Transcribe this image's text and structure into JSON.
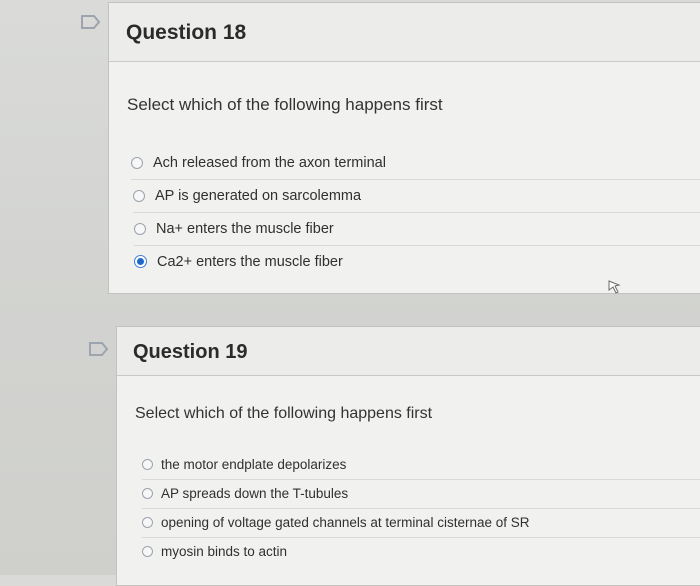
{
  "question18": {
    "title": "Question 18",
    "prompt": "Select which of the following happens first",
    "options": [
      {
        "label": "Ach released from the axon terminal",
        "selected": false
      },
      {
        "label": "AP is generated on sarcolemma",
        "selected": false
      },
      {
        "label": "Na+ enters the muscle fiber",
        "selected": false
      },
      {
        "label": "Ca2+ enters the muscle fiber",
        "selected": true
      }
    ]
  },
  "question19": {
    "title": "Question 19",
    "prompt": "Select which of the following happens first",
    "options": [
      {
        "label": "the motor endplate depolarizes",
        "selected": false
      },
      {
        "label": "AP spreads down the T-tubules",
        "selected": false
      },
      {
        "label": "opening of voltage gated channels at terminal cisternae of SR",
        "selected": false
      },
      {
        "label": "myosin binds to actin",
        "selected": false
      }
    ]
  },
  "colors": {
    "flag_outline": "#9ea4ae",
    "radio_selected": "#1c69c9"
  },
  "icons": {
    "flag": "flag-icon",
    "cursor": "mouse-cursor-icon"
  }
}
